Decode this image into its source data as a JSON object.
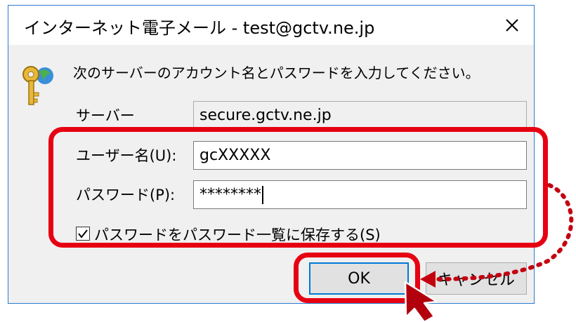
{
  "window": {
    "title": "インターネット電子メール - test@gctv.ne.jp",
    "close_icon": "close-icon"
  },
  "dialog": {
    "prompt": "次のサーバーのアカウント名とパスワードを入力してください。",
    "icon": "key-globe-icon",
    "server": {
      "label": "サーバー",
      "value": "secure.gctv.ne.jp"
    },
    "username": {
      "label": "ユーザー名(U):",
      "value": "gcXXXXX"
    },
    "password": {
      "label": "パスワード(P):",
      "value": "********"
    },
    "save_password": {
      "label": "パスワードをパスワード一覧に保存する(S)",
      "checked": true
    },
    "ok_label": "OK",
    "cancel_label": "キャンセル"
  },
  "annotations": {
    "highlight_color": "#e60012",
    "highlight_boxes": [
      "credentials-highlight",
      "ok-button-highlight"
    ],
    "arrow_icon": "dotted-arrow-icon",
    "cursor_icon": "pointer-cursor-icon"
  }
}
